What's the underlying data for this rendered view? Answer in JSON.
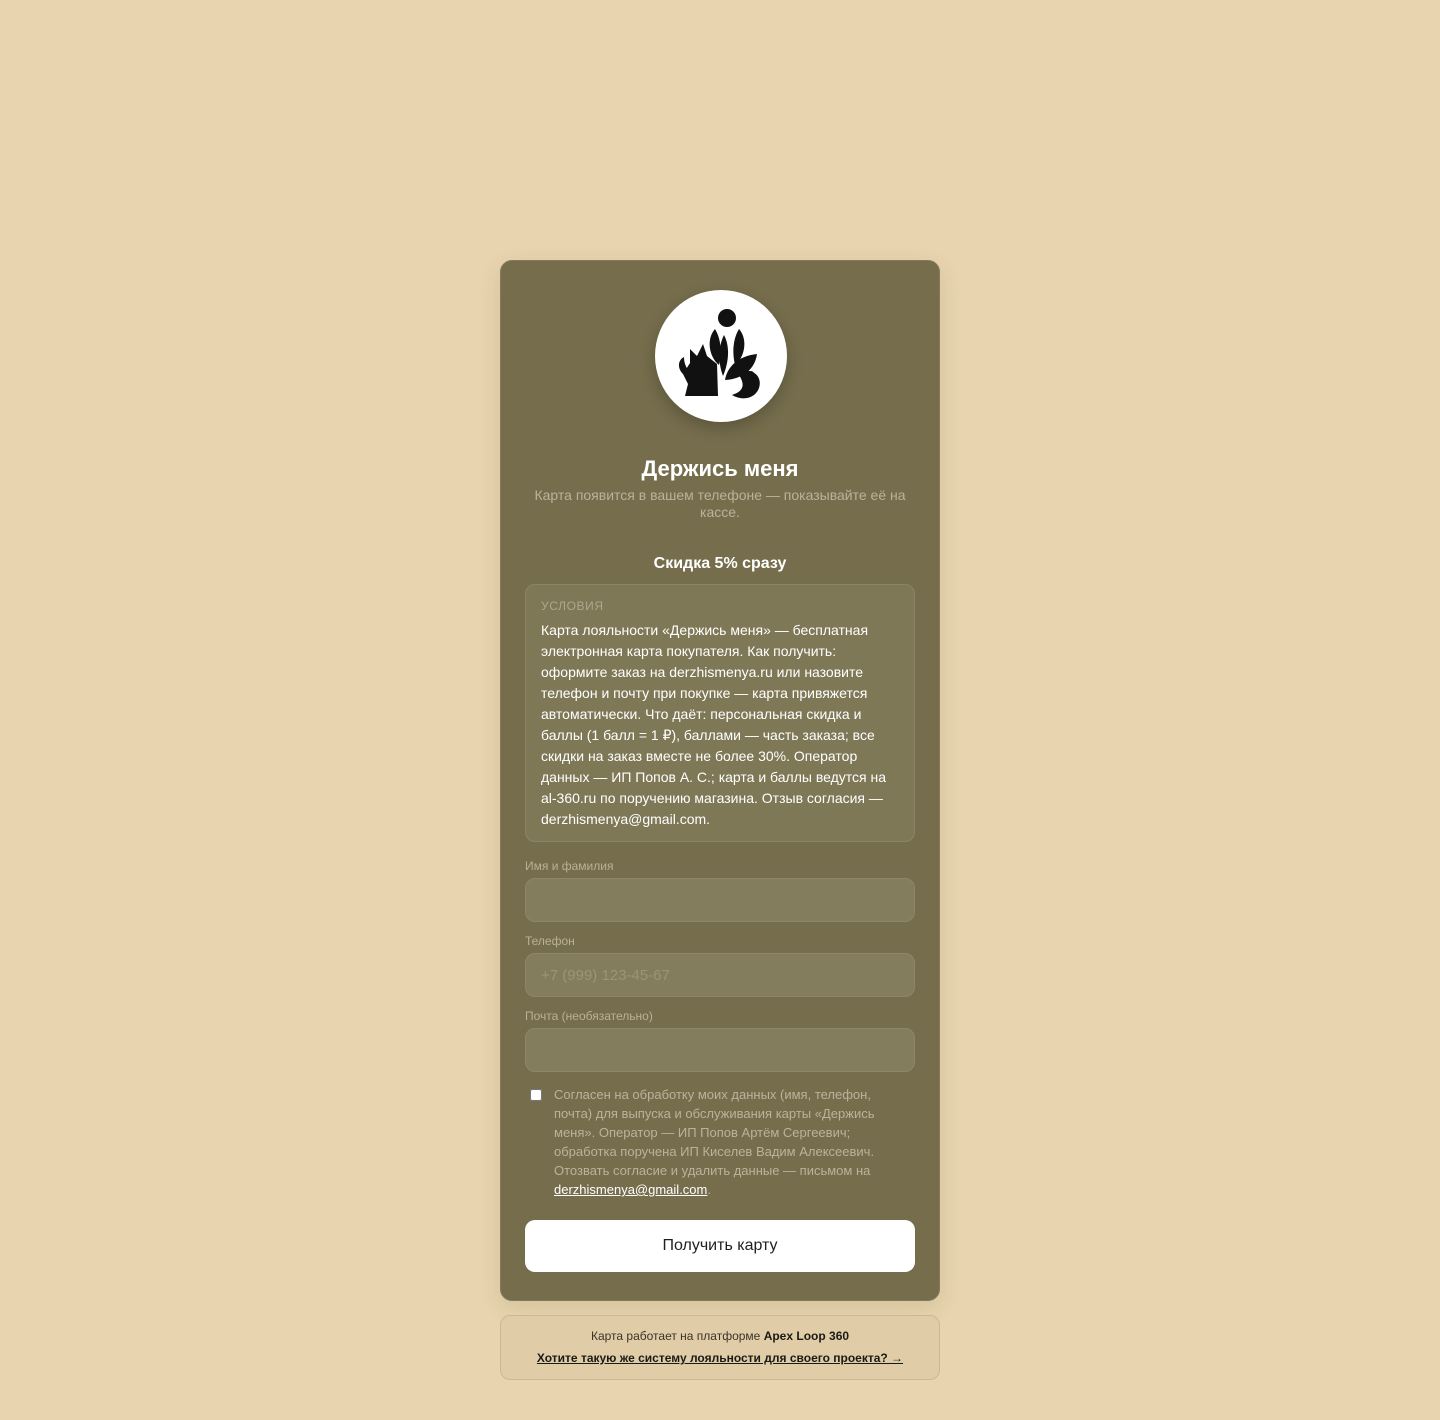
{
  "brand": {
    "title": "Держись меня",
    "logo_icon": "dog-plant-logo-icon"
  },
  "card": {
    "subtitle": "Карта появится в вашем телефоне — показывайте её на кассе.",
    "promo": "Скидка 5% сразу"
  },
  "terms": {
    "label": "УСЛОВИЯ",
    "text": "Карта лояльности «Держись меня» — бесплатная электронная карта покупателя. Как получить: оформите заказ на derzhismenya.ru или назовите телефон и почту при покупке — карта привяжется автоматически. Что даёт: персональная скидка и баллы (1 балл = 1 ₽), баллами — часть заказа; все скидки на заказ вместе не более 30%. Оператор данных — ИП Попов А. С.; карта и баллы ведутся на al-360.ru по поручению магазина. Отзыв согласия — derzhismenya@gmail.com."
  },
  "form": {
    "name_label": "Имя и фамилия",
    "name_value": "",
    "name_placeholder": "",
    "phone_label": "Телефон",
    "phone_value": "",
    "phone_placeholder": "+7 (999) 123-45-67",
    "email_label": "Почта (необязательно)",
    "email_value": "",
    "email_placeholder": "",
    "consent_checked": false,
    "consent_text": "Согласен на обработку моих данных (имя, телефон, почта) для выпуска и обслуживания карты «Держись меня». Оператор — ИП Попов Артём Сергеевич; обработка поручена ИП Киселев Вадим Алексеевич. Отозвать согласие и удалить данные — письмом на ",
    "consent_email": "derzhismenya@gmail.com",
    "consent_end": ".",
    "submit_label": "Получить карту"
  },
  "footer": {
    "platform_prefix": "Карта работает на платформе ",
    "platform_name": "Apex Loop 360",
    "cta_link": "Хотите такую же систему лояльности для своего проекта? →"
  },
  "colors": {
    "page_background": "#e8d5af",
    "card_background": "#756d4c",
    "button_background": "#ffffff"
  }
}
